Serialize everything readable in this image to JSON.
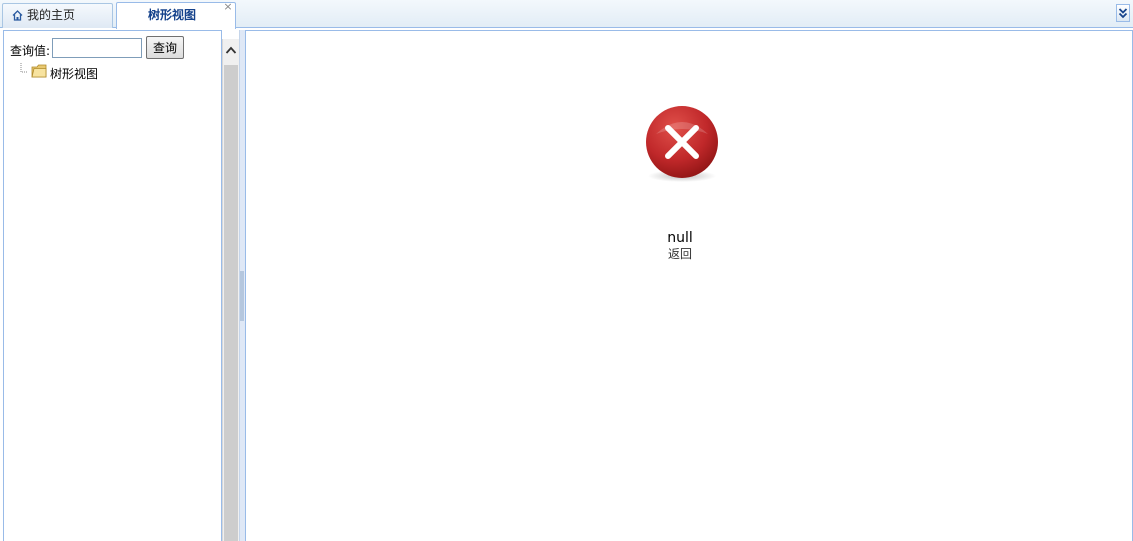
{
  "tabs": [
    {
      "label": "我的主页",
      "icon": "home-icon"
    },
    {
      "label": "树形视图",
      "closable": true,
      "close_symbol": "×"
    }
  ],
  "tabbar": {
    "scroll_icon": "double-chevron-down-icon"
  },
  "search": {
    "label": "查询值:",
    "value": "",
    "button_label": "查询"
  },
  "tree": {
    "root": {
      "label": "树形视图",
      "icon": "folder-icon"
    }
  },
  "main": {
    "error_icon": "error-x-icon",
    "error_color": "#c0282a",
    "message": "null",
    "back_label": "返回"
  },
  "colors": {
    "accent": "#15428b",
    "border": "#99bbe8"
  }
}
